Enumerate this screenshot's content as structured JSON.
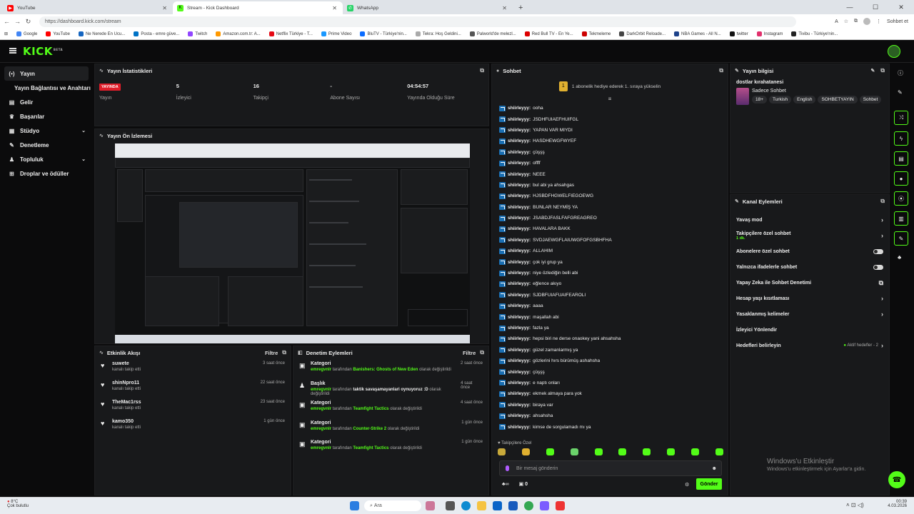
{
  "browser": {
    "tabs": [
      {
        "title": "YouTube",
        "color": "#ff0000",
        "glyph": "▶"
      },
      {
        "title": "Stream - Kick Dashboard",
        "color": "#53fc18",
        "glyph": "K"
      },
      {
        "title": "WhatsApp",
        "color": "#25d366",
        "glyph": "✆"
      }
    ],
    "url": "https://dashboard.kick.com/stream",
    "profile_button": "Sohbet et",
    "bookmarks": [
      {
        "label": "Google",
        "color": "#4285f4"
      },
      {
        "label": "YouTube",
        "color": "#ff0000"
      },
      {
        "label": "Ne Nerede En Ucu...",
        "color": "#1565c0"
      },
      {
        "label": "Posta - emre güve...",
        "color": "#0072c6"
      },
      {
        "label": "Twitch",
        "color": "#9146ff"
      },
      {
        "label": "Amazon.com.tr: A...",
        "color": "#ff9900"
      },
      {
        "label": "Netflix Türkiye - T...",
        "color": "#e50914"
      },
      {
        "label": "Prime Video",
        "color": "#1a98ff"
      },
      {
        "label": "BluTV - Türkiye'nin...",
        "color": "#0a6cff"
      },
      {
        "label": "Tekra: Hoş Geldini...",
        "color": "#aaaaaa"
      },
      {
        "label": "Palworld'de melezl...",
        "color": "#555555"
      },
      {
        "label": "Red Bull TV - En Ye...",
        "color": "#d00"
      },
      {
        "label": "Tekmeleme",
        "color": "#cc0000"
      },
      {
        "label": "DarkOrbit Reloade...",
        "color": "#444"
      },
      {
        "label": "NBA Games - All N...",
        "color": "#1d428a"
      },
      {
        "label": "twitter",
        "color": "#111"
      },
      {
        "label": "Instagram",
        "color": "#e1306c"
      },
      {
        "label": "Tivibu - Türkiye'nin...",
        "color": "#222"
      }
    ]
  },
  "app": {
    "logo": "KICK",
    "logo_badge": "BETA",
    "accent": "#53fc18"
  },
  "sidebar": {
    "items": [
      {
        "label": "Yayın",
        "icon": "(•)"
      },
      {
        "label": "Yayın Bağlantısı ve Anahtarı",
        "icon": ""
      },
      {
        "label": "Gelir",
        "icon": "▤"
      },
      {
        "label": "Başarılar",
        "icon": "♛"
      },
      {
        "label": "Stüdyo",
        "icon": "▦",
        "chevron": "⌄"
      },
      {
        "label": "Denetleme",
        "icon": "✎"
      },
      {
        "label": "Topluluk",
        "icon": "♟",
        "chevron": "⌄"
      },
      {
        "label": "Droplar ve ödüller",
        "icon": "⊞"
      }
    ]
  },
  "stats": {
    "title": "Yayın İstatistikleri",
    "live_badge": "YAYINDA",
    "items": [
      {
        "value": "",
        "label": "Yayın"
      },
      {
        "value": "5",
        "label": "İzleyici"
      },
      {
        "value": "16",
        "label": "Takipçi"
      },
      {
        "value": "-",
        "label": "Abone Sayısı"
      },
      {
        "value": "04:54:57",
        "label": "Yayında Olduğu Süre"
      }
    ]
  },
  "preview": {
    "title": "Yayın Ön İzlemesi"
  },
  "activity": {
    "title": "Etkinlik Akışı",
    "filter": "Filtre",
    "items": [
      {
        "name": "suwete",
        "sub": "kanalı takip etti",
        "time": "3 saat önce"
      },
      {
        "name": "shinNpro11",
        "sub": "kanalı takip etti",
        "time": "22 saat önce"
      },
      {
        "name": "TheMac1rss",
        "sub": "kanalı takip etti",
        "time": "23 saat önce"
      },
      {
        "name": "kamo350",
        "sub": "kanalı takip etti",
        "time": "1 gün önce"
      }
    ]
  },
  "moderation": {
    "title": "Denetim Eylemleri",
    "filter": "Filtre",
    "items": [
      {
        "type": "Kategori",
        "user": "emregvnlr",
        "mid": "tarafından",
        "value": "Banishers: Ghosts of New Eden",
        "tail": "olarak değiştirildi",
        "time": "2 saat önce"
      },
      {
        "type": "Başlık",
        "user": "emregvnlr",
        "mid": "tarafından",
        "value": "taktik savaşamayanlari oynuyoruz :D",
        "tail": "olarak değiştirildi",
        "time": "4 saat önce"
      },
      {
        "type": "Kategori",
        "user": "emregvnlr",
        "mid": "tarafından",
        "value": "Teamfight Tactics",
        "tail": "olarak değiştirildi",
        "time": "4 saat önce"
      },
      {
        "type": "Kategori",
        "user": "emregvnlr",
        "mid": "tarafından",
        "value": "Counter-Strike 2",
        "tail": "olarak değiştirildi",
        "time": "1 gün önce"
      },
      {
        "type": "Kategori",
        "user": "emregvnlr",
        "mid": "tarafından",
        "value": "Teamfight Tactics",
        "tail": "olarak değiştirildi",
        "time": "1 gün önce"
      }
    ]
  },
  "chat": {
    "title": "Sohbet",
    "pinned": "1 abonelik hediye ederek 1. sıraya yükselin",
    "messages": [
      {
        "user": "shiirleyyy:",
        "text": "ooha"
      },
      {
        "user": "shiirleyyy:",
        "text": "JSDHFUIAEFHUIFGL"
      },
      {
        "user": "shiirleyyy:",
        "text": "YAPAN VAR MIYDI"
      },
      {
        "user": "shiirleyyy:",
        "text": "HASDHEWGFWYEF"
      },
      {
        "user": "shiirleyyy:",
        "text": "çüşşş"
      },
      {
        "user": "shiirleyyy:",
        "text": "offff"
      },
      {
        "user": "shiirleyyy:",
        "text": "NEEE"
      },
      {
        "user": "shiirleyyy:",
        "text": "bul abi ya ahsahgas"
      },
      {
        "user": "shiirleyyy:",
        "text": "HJSBDFHGWELFIEGOEWG"
      },
      {
        "user": "shiirleyyy:",
        "text": "BUNLAR NEYMİŞ YA"
      },
      {
        "user": "shiirleyyy:",
        "text": "JSABDJFASLFAFGREAGREO"
      },
      {
        "user": "shiirleyyy:",
        "text": "HAVALARA BAKK"
      },
      {
        "user": "shiirleyyy:",
        "text": "SVDJAEWGFLAIUWGFOFGSBHFHA"
      },
      {
        "user": "shiirleyyy:",
        "text": "ALLAHIM"
      },
      {
        "user": "shiirleyyy:",
        "text": "çok iyi grup ya"
      },
      {
        "user": "shiirleyyy:",
        "text": "niye özlediğin belli abi"
      },
      {
        "user": "shiirleyyy:",
        "text": "eğlence akıyo"
      },
      {
        "user": "shiirleyyy:",
        "text": "SJDBFUIAFUAIFEAROLI"
      },
      {
        "user": "shiirleyyy:",
        "text": "aaaa"
      },
      {
        "user": "shiirleyyy:",
        "text": "maşallah abi"
      },
      {
        "user": "shiirleyyy:",
        "text": "fazla ya"
      },
      {
        "user": "shiirleyyy:",
        "text": "hepsi biri ne derse onaokey yani ahsahsha"
      },
      {
        "user": "shiirleyyy:",
        "text": "güzel zamanlarmış ya"
      },
      {
        "user": "shiirleyyy:",
        "text": "gözlerini hırs bürümüş ashahsha"
      },
      {
        "user": "shiirleyyy:",
        "text": "çüşşş"
      },
      {
        "user": "shiirleyyy:",
        "text": "e naptı onları"
      },
      {
        "user": "shiirleyyy:",
        "text": "ekmek almaya para yok"
      },
      {
        "user": "shiirleyyy:",
        "text": "biraya var"
      },
      {
        "user": "shiirleyyy:",
        "text": "ahsahsha"
      },
      {
        "user": "shiirleyyy:",
        "text": "kimse de sorgulamadı mı ya"
      }
    ],
    "mode_label": "Takipçilere Özel",
    "input_placeholder": "Bir mesaj gönderin",
    "counter": "0",
    "send_label": "Gönder"
  },
  "stream_info": {
    "title": "Yayın bilgisi",
    "stream_title": "dostlar kırahatanesi",
    "category": "Sadece Sohbet",
    "tags": [
      "18+",
      "Turkish",
      "English",
      "SOHBETYAYIN",
      "Sohbet"
    ]
  },
  "channel_actions": {
    "title": "Kanal Eylemleri",
    "rows": [
      {
        "label": "Yavaş mod",
        "control": "chevron"
      },
      {
        "label": "Takipçilere özel sohbet",
        "sub": "1 dk.",
        "control": "chevron"
      },
      {
        "label": "Abonelere özel sohbet",
        "control": "toggle"
      },
      {
        "label": "Yalnızca ifadelerle sohbet",
        "control": "toggle"
      },
      {
        "label": "Yapay Zeka ile Sohbet Denetimi",
        "control": "external"
      },
      {
        "label": "Hesap yaşı kısıtlaması",
        "control": "chevron"
      },
      {
        "label": "Yasaklanmış kelimeler",
        "control": "chevron"
      },
      {
        "label": "İzleyici Yönlendir",
        "control": "none"
      },
      {
        "label": "Hedefleri belirleyin",
        "extra": "Aktif hedefler - 2",
        "control": "chevron"
      }
    ]
  },
  "watermark": {
    "title": "Windows'u Etkinleştir",
    "sub": "Windows'u etkinleştirmek için Ayarlar'a gidin."
  },
  "taskbar": {
    "weather_temp": "8°C",
    "weather_text": "Çok bulutlu",
    "search_placeholder": "Ara",
    "time": "00:39",
    "date": "4.03.2026"
  }
}
